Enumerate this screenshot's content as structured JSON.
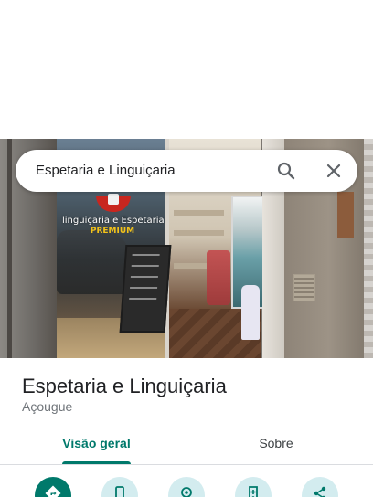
{
  "search": {
    "query": "Espetaria e Linguiçaria"
  },
  "photo": {
    "sign_text": "linguiçaria e Espetaria",
    "sign_premium": "PREMIUM"
  },
  "place": {
    "name": "Espetaria e Linguiçaria",
    "category": "Açougue"
  },
  "tabs": [
    {
      "label": "Visão geral",
      "selected": true
    },
    {
      "label": "Sobre",
      "selected": false
    }
  ],
  "actions": [
    {
      "icon": "directions-icon"
    },
    {
      "icon": "phone-icon"
    },
    {
      "icon": "nearby-icon"
    },
    {
      "icon": "save-add-icon"
    },
    {
      "icon": "share-icon"
    }
  ],
  "colors": {
    "accent": "#00796b",
    "action_bg": "#d3ecef",
    "text_primary": "#202124",
    "text_secondary": "#70757a"
  }
}
